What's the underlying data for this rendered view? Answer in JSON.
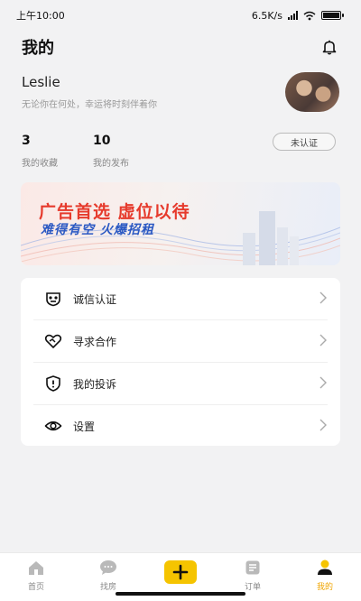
{
  "status": {
    "time": "上午10:00",
    "net_speed": "6.5K/s"
  },
  "header": {
    "title": "我的"
  },
  "profile": {
    "username": "Leslie",
    "motto": "无论你在何处，幸运将时刻伴着你"
  },
  "stats": [
    {
      "value": "3",
      "label": "我的收藏"
    },
    {
      "value": "10",
      "label": "我的发布"
    }
  ],
  "verify_badge": "未认证",
  "banner": {
    "line1": "广告首选  虚位以待",
    "line2": "难得有空  火爆招租"
  },
  "menu": [
    {
      "label": "诚信认证",
      "icon": "credit-icon"
    },
    {
      "label": "寻求合作",
      "icon": "handshake-icon"
    },
    {
      "label": "我的投诉",
      "icon": "complaint-icon"
    },
    {
      "label": "设置",
      "icon": "eye-settings-icon"
    }
  ],
  "tabs": [
    {
      "label": "首页",
      "icon": "home-icon"
    },
    {
      "label": "找房",
      "icon": "chat-icon"
    },
    {
      "label": "",
      "icon": "plus-icon"
    },
    {
      "label": "订单",
      "icon": "order-icon"
    },
    {
      "label": "我的",
      "icon": "user-icon",
      "active": true
    }
  ],
  "colors": {
    "accent": "#f5c400",
    "banner_red": "#e63a2c",
    "banner_blue": "#2b59c3"
  }
}
